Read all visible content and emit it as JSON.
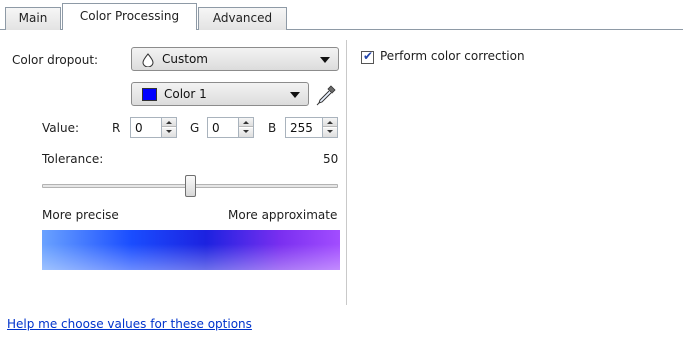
{
  "tabs": [
    {
      "label": "Main",
      "active": false
    },
    {
      "label": "Color Processing",
      "active": true
    },
    {
      "label": "Advanced",
      "active": false
    }
  ],
  "color_dropout": {
    "label": "Color dropout:",
    "selected": "Custom",
    "icon": "droplet-icon"
  },
  "color_select": {
    "selected": "Color 1",
    "swatch_color": "#0000ff",
    "picker_icon": "eyedropper-icon"
  },
  "value": {
    "label": "Value:",
    "r_label": "R",
    "r": "0",
    "g_label": "G",
    "g": "0",
    "b_label": "B",
    "b": "255"
  },
  "tolerance": {
    "label": "Tolerance:",
    "value": "50",
    "slider_fraction": 0.5
  },
  "scale": {
    "left_label": "More precise",
    "right_label": "More approximate"
  },
  "color_correction": {
    "label": "Perform color correction",
    "checked": true
  },
  "help_link": "Help me choose values for these options",
  "colors": {
    "accent": "#0033cc",
    "border": "#8e9aa6"
  }
}
